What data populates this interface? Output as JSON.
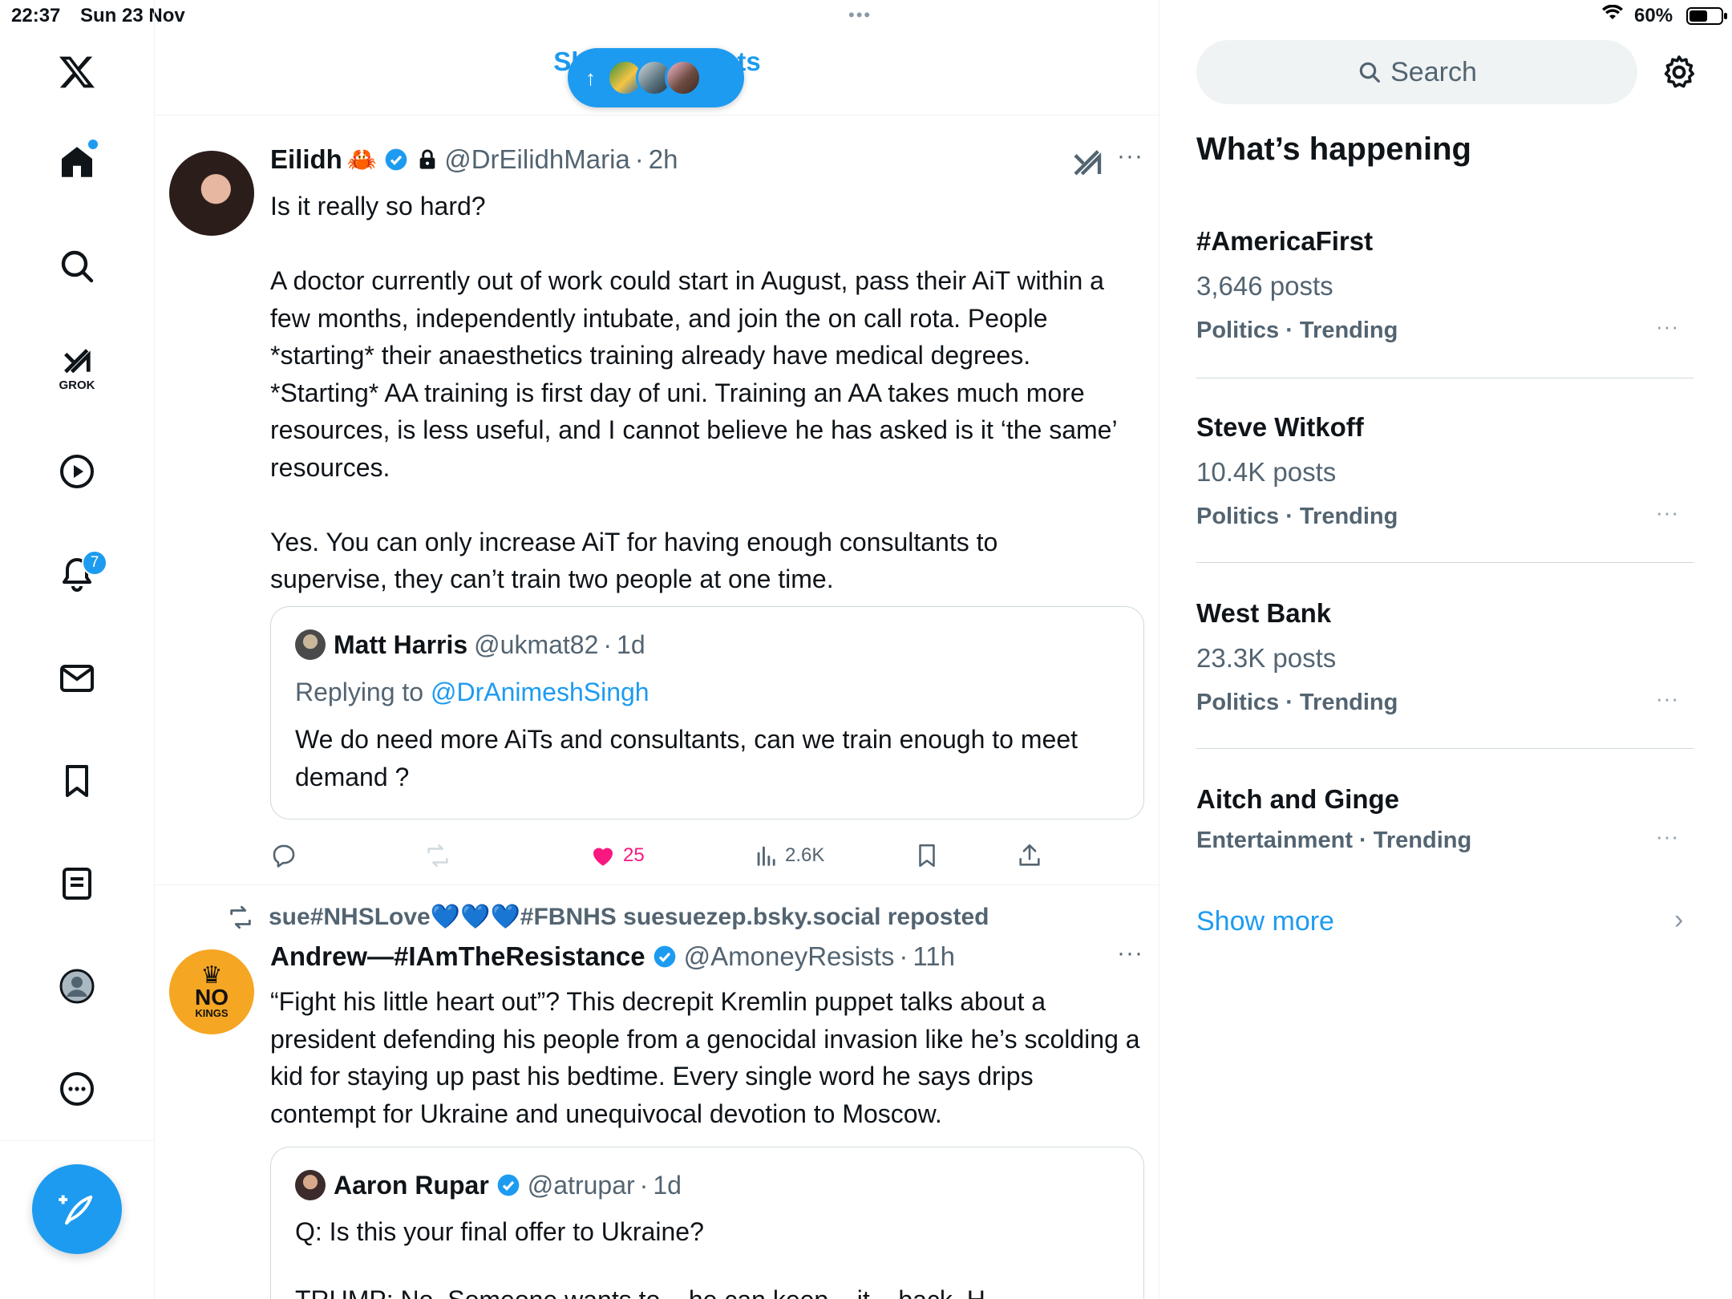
{
  "status_bar": {
    "time": "22:37",
    "date": "Sun 23 Nov",
    "battery_percent": "60%",
    "center_dots": "•••"
  },
  "nav": {
    "grok_label": "GROK",
    "notifications_badge": "7",
    "items": [
      "home-icon",
      "search-icon",
      "grok-icon",
      "video-icon",
      "bell-icon",
      "mail-icon",
      "bookmark-icon",
      "list-icon",
      "profile-icon",
      "more-icon"
    ]
  },
  "header": {
    "tab_label": "Show new posts"
  },
  "posts": [
    {
      "display_name": "Eilidh",
      "emoji": "🦀",
      "handle": "@DrEilidhMaria",
      "sep": "·",
      "time": "2h",
      "more": "···",
      "text": "Is it really so hard?\n\nA doctor currently out of work could start in August, pass their AiT within a few months, independently intubate, and join the on call rota. People *starting* their anaesthetics training already have medical degrees. *Starting* AA training is first day of uni. Training an AA takes much more resources, is less useful, and I cannot believe he has asked is it ‘the same’ resources.\n\nYes. You can only increase AiT for having enough consultants to supervise, they can’t train two people at one time.",
      "quote": {
        "display_name": "Matt Harris",
        "handle": "@ukmat82",
        "sep": "·",
        "time": "1d",
        "replying_prefix": "Replying to ",
        "replying_to": "@DrAnimeshSingh",
        "text": "We do need more AiTs and consultants, can we train enough to meet demand ?"
      },
      "likes": "25",
      "views": "2.6K"
    },
    {
      "repost_by": "sue#NHSLove💙💙💙#FBNHS suesuezep.bsky.social reposted",
      "display_name": "Andrew—#IAmTheResistance",
      "handle": "@AmoneyResists",
      "sep": "·",
      "time": "11h",
      "more": "···",
      "avatar_text_top": "NO",
      "avatar_text_bottom": "KINGS",
      "text": "“Fight his little heart out”? This decrepit Kremlin puppet talks about a president defending his people from a genocidal invasion like he’s scolding a kid for staying up past his bedtime. Every single word he says drips contempt for Ukraine and unequivocal devotion to Moscow.",
      "quote": {
        "display_name": "Aaron Rupar",
        "handle": "@atrupar",
        "sep": "·",
        "time": "1d",
        "text": "Q: Is this your final offer to Ukraine?",
        "cut_line": "TRUMP: No. Someone wants to... he can keep... it... back. H..."
      }
    }
  ],
  "sidebar": {
    "search_placeholder": "Search",
    "title": "What’s happening",
    "trends": [
      {
        "name": "#AmericaFirst",
        "posts": "3,646 posts",
        "meta": "Politics · Trending"
      },
      {
        "name": "Steve Witkoff",
        "posts": "10.4K posts",
        "meta": "Politics · Trending"
      },
      {
        "name": "West Bank",
        "posts": "23.3K posts",
        "meta": "Politics · Trending"
      },
      {
        "name": "Aitch and Ginge",
        "posts": "",
        "meta": "Entertainment · Trending"
      }
    ],
    "trend_more": "···",
    "show_more": "Show more",
    "chevron": "›"
  },
  "colors": {
    "accent": "#1d9bf0",
    "like": "#f91880",
    "secondary_text": "#536471",
    "border": "#eff3f4"
  }
}
